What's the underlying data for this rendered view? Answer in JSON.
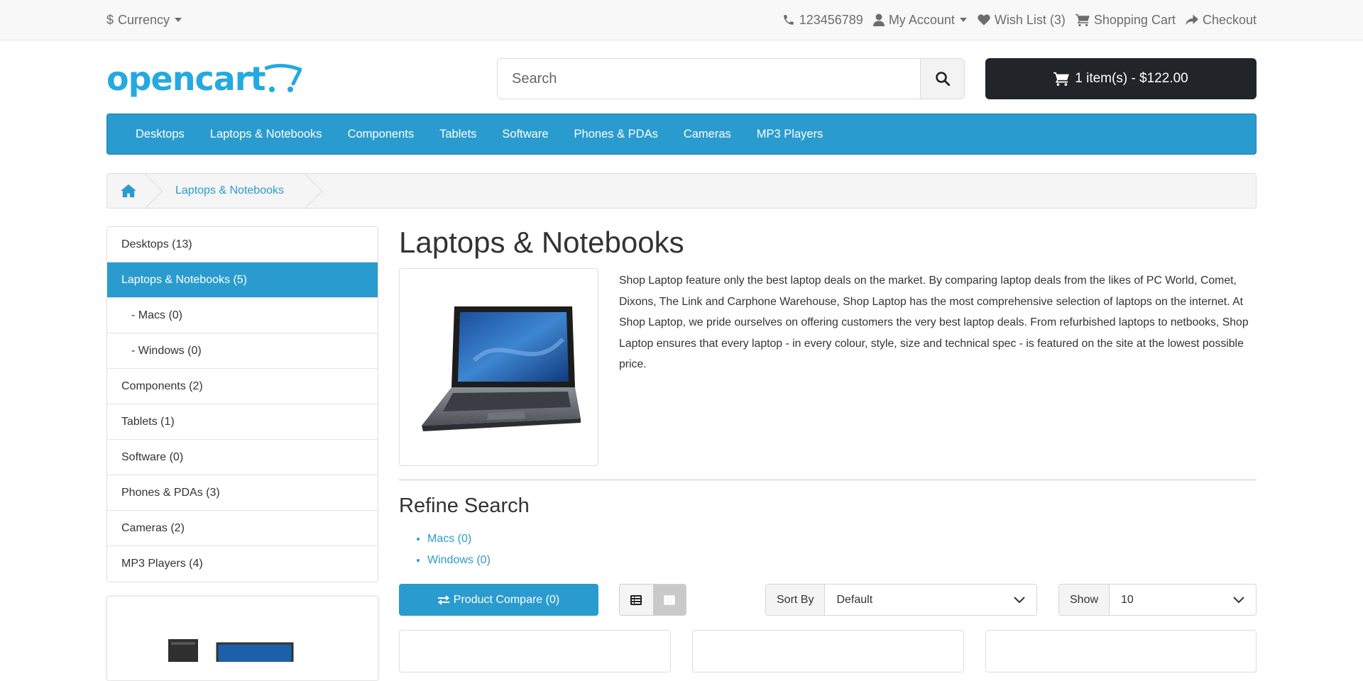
{
  "topbar": {
    "currency": "Currency",
    "phone": "123456789",
    "account": "My Account",
    "wishlist": "Wish List (3)",
    "cart": "Shopping Cart",
    "checkout": "Checkout"
  },
  "header": {
    "logo": "opencart",
    "search_placeholder": "Search",
    "cart_button": "1 item(s) - $122.00"
  },
  "menu": {
    "items": [
      "Desktops",
      "Laptops & Notebooks",
      "Components",
      "Tablets",
      "Software",
      "Phones & PDAs",
      "Cameras",
      "MP3 Players"
    ]
  },
  "breadcrumb": {
    "current": "Laptops & Notebooks"
  },
  "sidebar": {
    "items": [
      {
        "label": "Desktops (13)"
      },
      {
        "label": "Laptops & Notebooks (5)"
      },
      {
        "label": "- Macs (0)"
      },
      {
        "label": "- Windows (0)"
      },
      {
        "label": "Components (2)"
      },
      {
        "label": "Tablets (1)"
      },
      {
        "label": "Software (0)"
      },
      {
        "label": "Phones & PDAs (3)"
      },
      {
        "label": "Cameras (2)"
      },
      {
        "label": "MP3 Players (4)"
      }
    ]
  },
  "main": {
    "title": "Laptops & Notebooks",
    "description": "Shop Laptop feature only the best laptop deals on the market. By comparing laptop deals from the likes of PC World, Comet, Dixons, The Link and Carphone Warehouse, Shop Laptop has the most comprehensive selection of laptops on the internet. At Shop Laptop, we pride ourselves on offering customers the very best laptop deals. From refurbished laptops to netbooks, Shop Laptop ensures that every laptop - in every colour, style, size and technical spec - is featured on the site at the lowest possible price.",
    "refine_title": "Refine Search",
    "refine_items": [
      "Macs (0)",
      "Windows (0)"
    ],
    "compare_button": "Product Compare (0)",
    "sort_label": "Sort By",
    "sort_value": "Default",
    "show_label": "Show",
    "show_value": "10"
  },
  "colors": {
    "accent": "#2a9bce",
    "dark": "#212529",
    "logo": "#24a9e1"
  }
}
